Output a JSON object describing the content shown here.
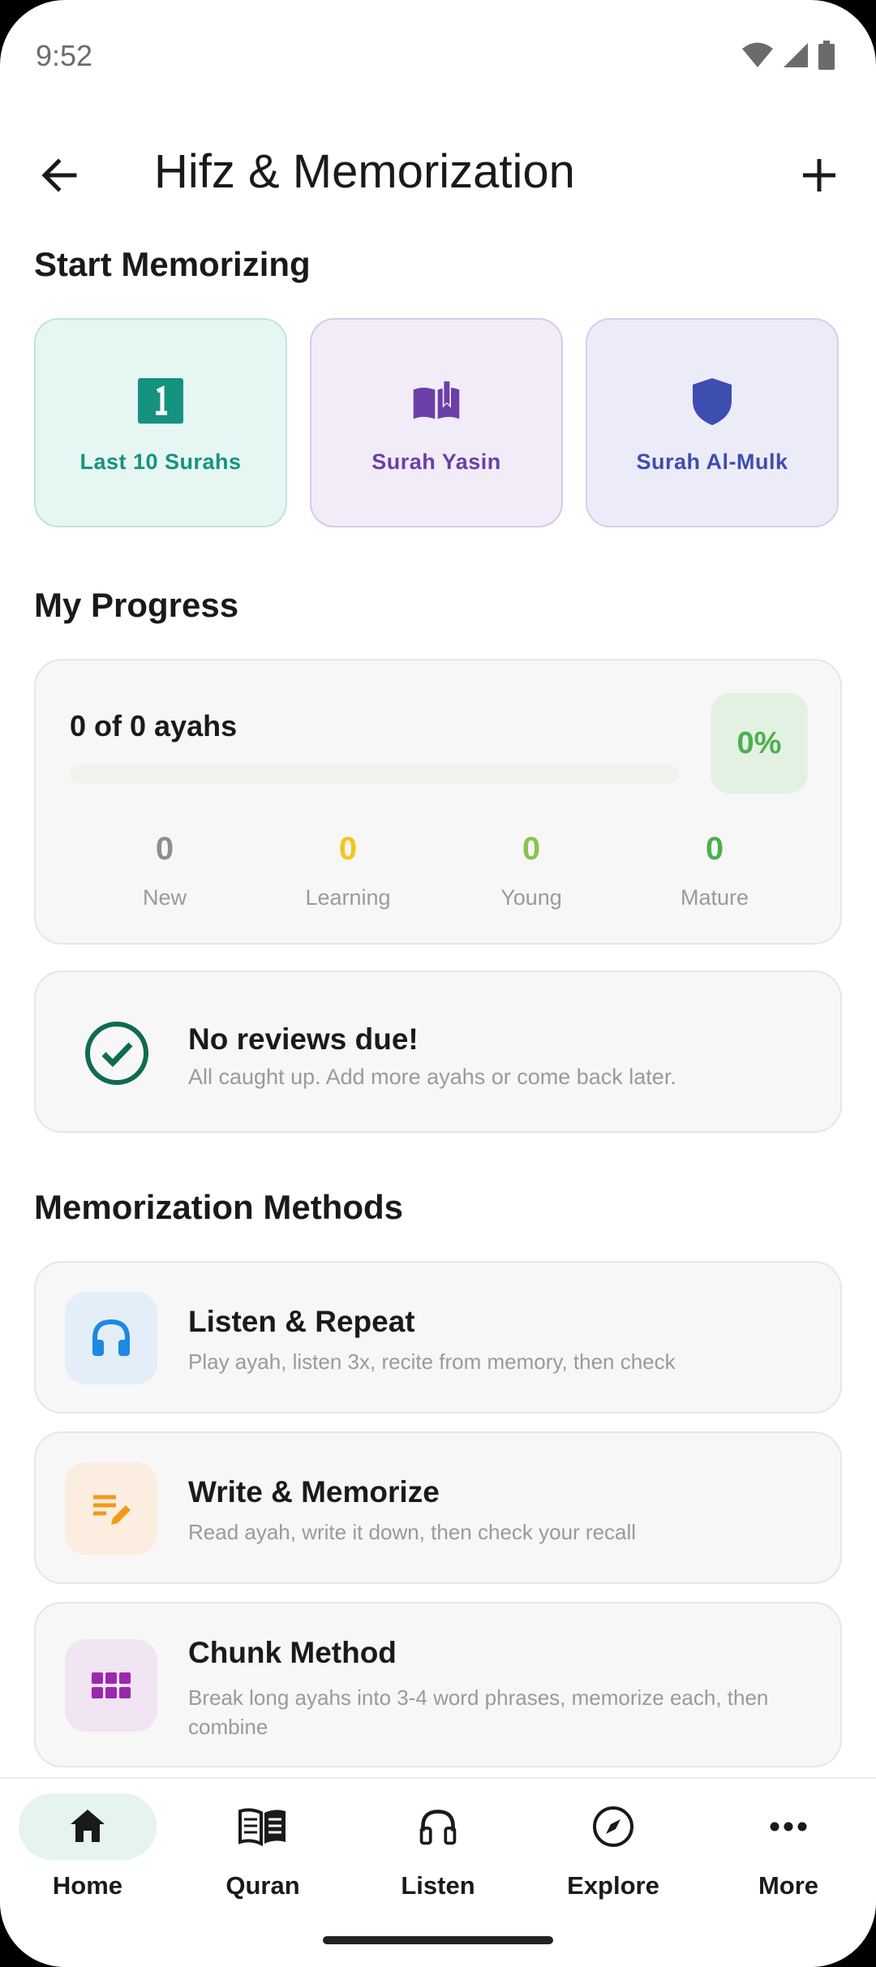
{
  "status_bar": {
    "time": "9:52"
  },
  "app_bar": {
    "title": "Hifz & Memorization"
  },
  "start": {
    "title": "Start Memorizing",
    "cards": [
      {
        "label": "Last 10 Surahs",
        "icon": "number-one-icon",
        "color": "#15937f"
      },
      {
        "label": "Surah Yasin",
        "icon": "open-book-icon",
        "color": "#6b3fa8"
      },
      {
        "label": "Surah Al-Mulk",
        "icon": "shield-icon",
        "color": "#3e4db0"
      }
    ]
  },
  "progress": {
    "title": "My Progress",
    "count_text": "0 of 0 ayahs",
    "percent_label": "0%",
    "percent_value": 0,
    "stats": [
      {
        "value": "0",
        "label": "New",
        "color": "#8e8e8e"
      },
      {
        "value": "0",
        "label": "Learning",
        "color": "#f5c518"
      },
      {
        "value": "0",
        "label": "Young",
        "color": "#8bc34a"
      },
      {
        "value": "0",
        "label": "Mature",
        "color": "#4caf50"
      }
    ]
  },
  "reviews": {
    "title": "No reviews due!",
    "subtitle": "All caught up. Add more ayahs or come back later.",
    "icon": "check-circle-icon"
  },
  "methods": {
    "title": "Memorization Methods",
    "items": [
      {
        "title": "Listen & Repeat",
        "desc": "Play ayah, listen 3x, recite from memory, then check",
        "icon": "headphones-icon",
        "bg": "#e3eef9",
        "color": "#1e88e5"
      },
      {
        "title": "Write & Memorize",
        "desc": "Read ayah, write it down, then check your recall",
        "icon": "edit-note-icon",
        "bg": "#fbeee0",
        "color": "#f29a16"
      },
      {
        "title": "Chunk Method",
        "desc": "Break long ayahs into 3-4 word phrases, memorize each, then combine",
        "icon": "grid-icon",
        "bg": "#f1e4f3",
        "color": "#9c27b0"
      }
    ]
  },
  "nav": {
    "items": [
      {
        "label": "Home",
        "icon": "home-icon",
        "active": true
      },
      {
        "label": "Quran",
        "icon": "book-icon"
      },
      {
        "label": "Listen",
        "icon": "headphones-icon"
      },
      {
        "label": "Explore",
        "icon": "compass-icon"
      },
      {
        "label": "More",
        "icon": "more-horiz-icon"
      }
    ]
  }
}
